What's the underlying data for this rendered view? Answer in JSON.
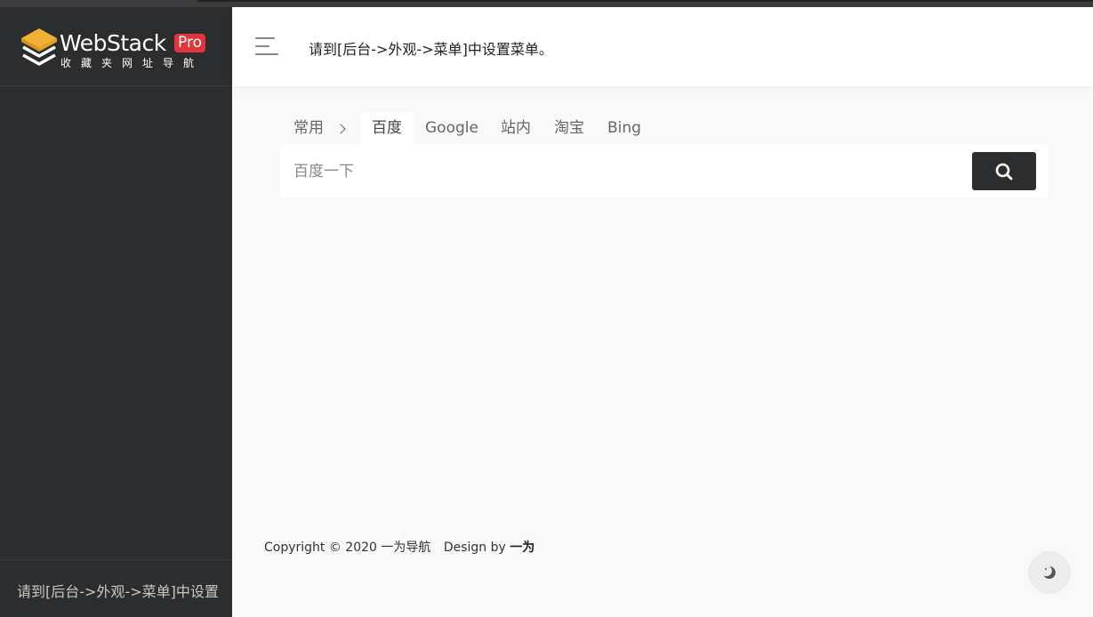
{
  "sidebar": {
    "logo": {
      "word": "WebStack",
      "badge": "Pro",
      "tagline": "收藏夹网址导航"
    },
    "footer_text": "请到[后台->外观->菜单]中设置"
  },
  "header": {
    "menu_text": "请到[后台->外观->菜单]中设置菜单。"
  },
  "search": {
    "group_label": "常用",
    "tabs": [
      {
        "label": "百度",
        "active": true
      },
      {
        "label": "Google",
        "active": false
      },
      {
        "label": "站内",
        "active": false
      },
      {
        "label": "淘宝",
        "active": false
      },
      {
        "label": "Bing",
        "active": false
      }
    ],
    "placeholder": "百度一下"
  },
  "footer": {
    "copyright": "Copyright © 2020 一为导航",
    "design_by": "Design by",
    "designer": "一为"
  },
  "colors": {
    "sidebar": "#2c2d2f",
    "badge": "#e2343b",
    "logo_mark": "#f2b134"
  }
}
